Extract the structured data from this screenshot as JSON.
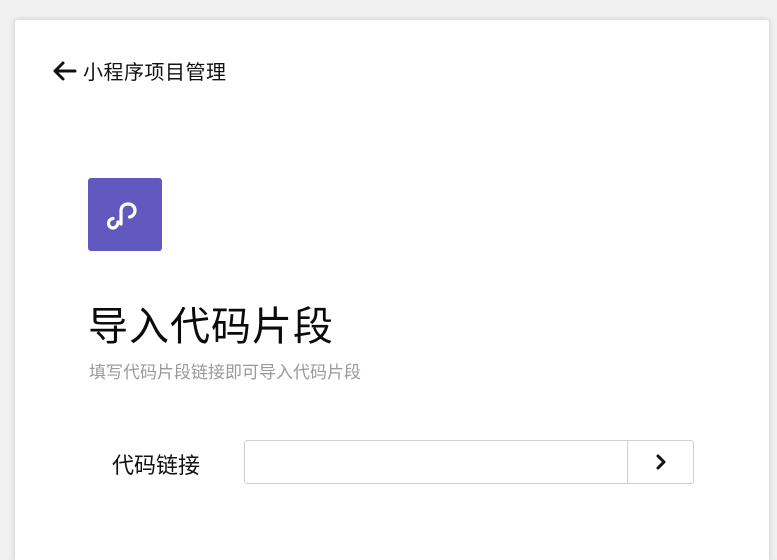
{
  "header": {
    "back_label": "小程序项目管理"
  },
  "app_icon": {
    "icon": "mini-program-icon",
    "color": "#6159c0"
  },
  "page": {
    "title": "导入代码片段",
    "subtitle": "填写代码片段链接即可导入代码片段"
  },
  "form": {
    "link_label": "代码链接",
    "link_value": "",
    "link_placeholder": "",
    "submit_icon": "chevron-right-icon"
  }
}
